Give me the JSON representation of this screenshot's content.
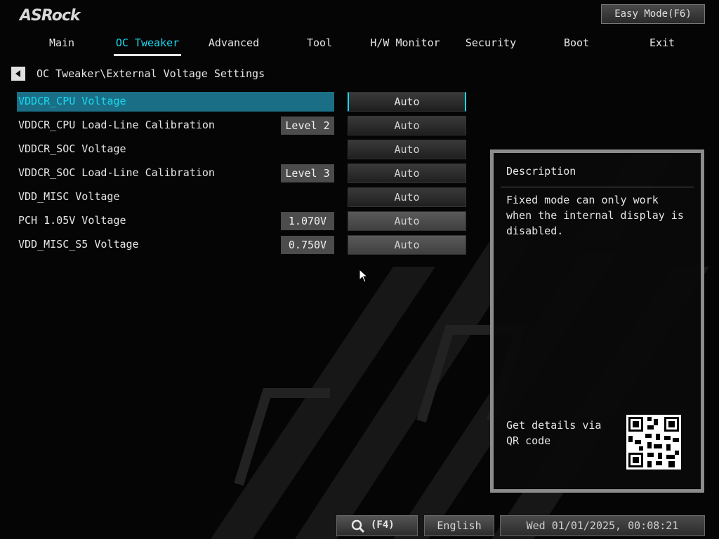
{
  "brand": "ASRock",
  "easy_mode_label": "Easy Mode(F6)",
  "nav": {
    "tabs": [
      {
        "label": "Main"
      },
      {
        "label": "OC Tweaker",
        "active": true
      },
      {
        "label": "Advanced"
      },
      {
        "label": "Tool"
      },
      {
        "label": "H/W Monitor"
      },
      {
        "label": "Security"
      },
      {
        "label": "Boot"
      },
      {
        "label": "Exit"
      }
    ]
  },
  "breadcrumb": "OC Tweaker\\External Voltage Settings",
  "settings": [
    {
      "label": "VDDCR_CPU Voltage",
      "badge": "",
      "value": "Auto",
      "selected": true
    },
    {
      "label": "VDDCR_CPU Load-Line Calibration",
      "badge": "Level 2",
      "value": "Auto"
    },
    {
      "label": "VDDCR_SOC Voltage",
      "badge": "",
      "value": "Auto"
    },
    {
      "label": "VDDCR_SOC Load-Line Calibration",
      "badge": "Level 3",
      "value": "Auto"
    },
    {
      "label": "VDD_MISC Voltage",
      "badge": "",
      "value": "Auto"
    },
    {
      "label": "PCH 1.05V Voltage",
      "badge": "1.070V",
      "value": "Auto"
    },
    {
      "label": "VDD_MISC_S5 Voltage",
      "badge": "0.750V",
      "value": "Auto"
    }
  ],
  "description": {
    "title": "Description",
    "body": "Fixed mode can only work when the internal display is disabled.",
    "qr_text": "Get details via QR code"
  },
  "footer": {
    "search_key": "(F4)",
    "language": "English",
    "datetime": "Wed 01/01/2025, 00:08:21"
  },
  "colors": {
    "accent": "#18d8f0",
    "highlight": "#1a6f86",
    "background": "#050505"
  },
  "icons": {
    "back": "back-arrow-icon",
    "search": "search-icon",
    "qr": "qr-code-icon",
    "cursor": "mouse-pointer-icon"
  }
}
